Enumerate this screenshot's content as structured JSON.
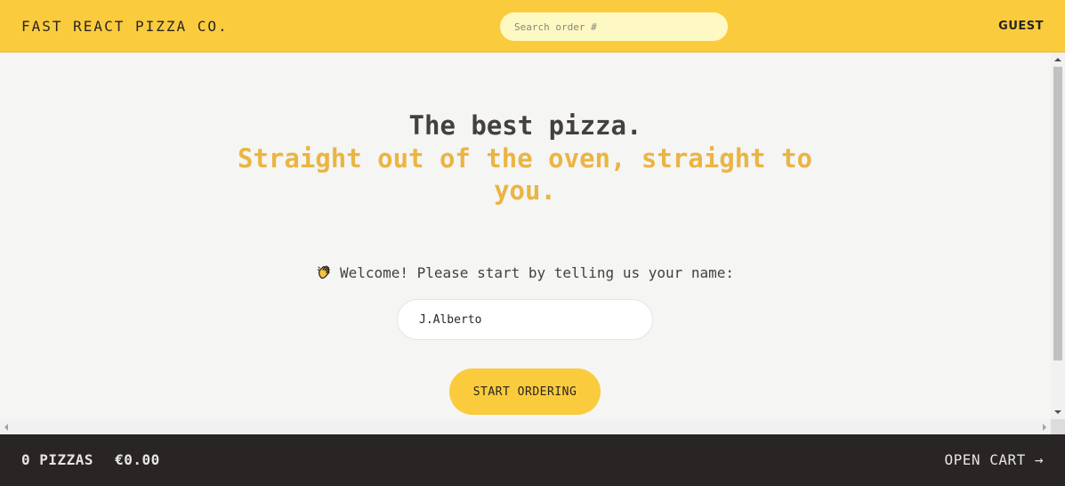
{
  "header": {
    "logo": "FAST REACT PIZZA CO.",
    "search_placeholder": "Search order #",
    "username": "GUEST"
  },
  "home": {
    "headline": "The best pizza.",
    "tagline": "Straight out of the oven, straight to you.",
    "welcome_text": "Welcome! Please start by telling us your name:",
    "name_value": "J.Alberto",
    "start_button": "START ORDERING"
  },
  "cart": {
    "pizza_count": "0 PIZZAS",
    "total": "€0.00",
    "open_cart_label": "OPEN CART →"
  },
  "colors": {
    "brand_yellow": "#facc3d",
    "accent_text": "#eab543",
    "dark": "#292524",
    "background": "#f5f5f4"
  }
}
